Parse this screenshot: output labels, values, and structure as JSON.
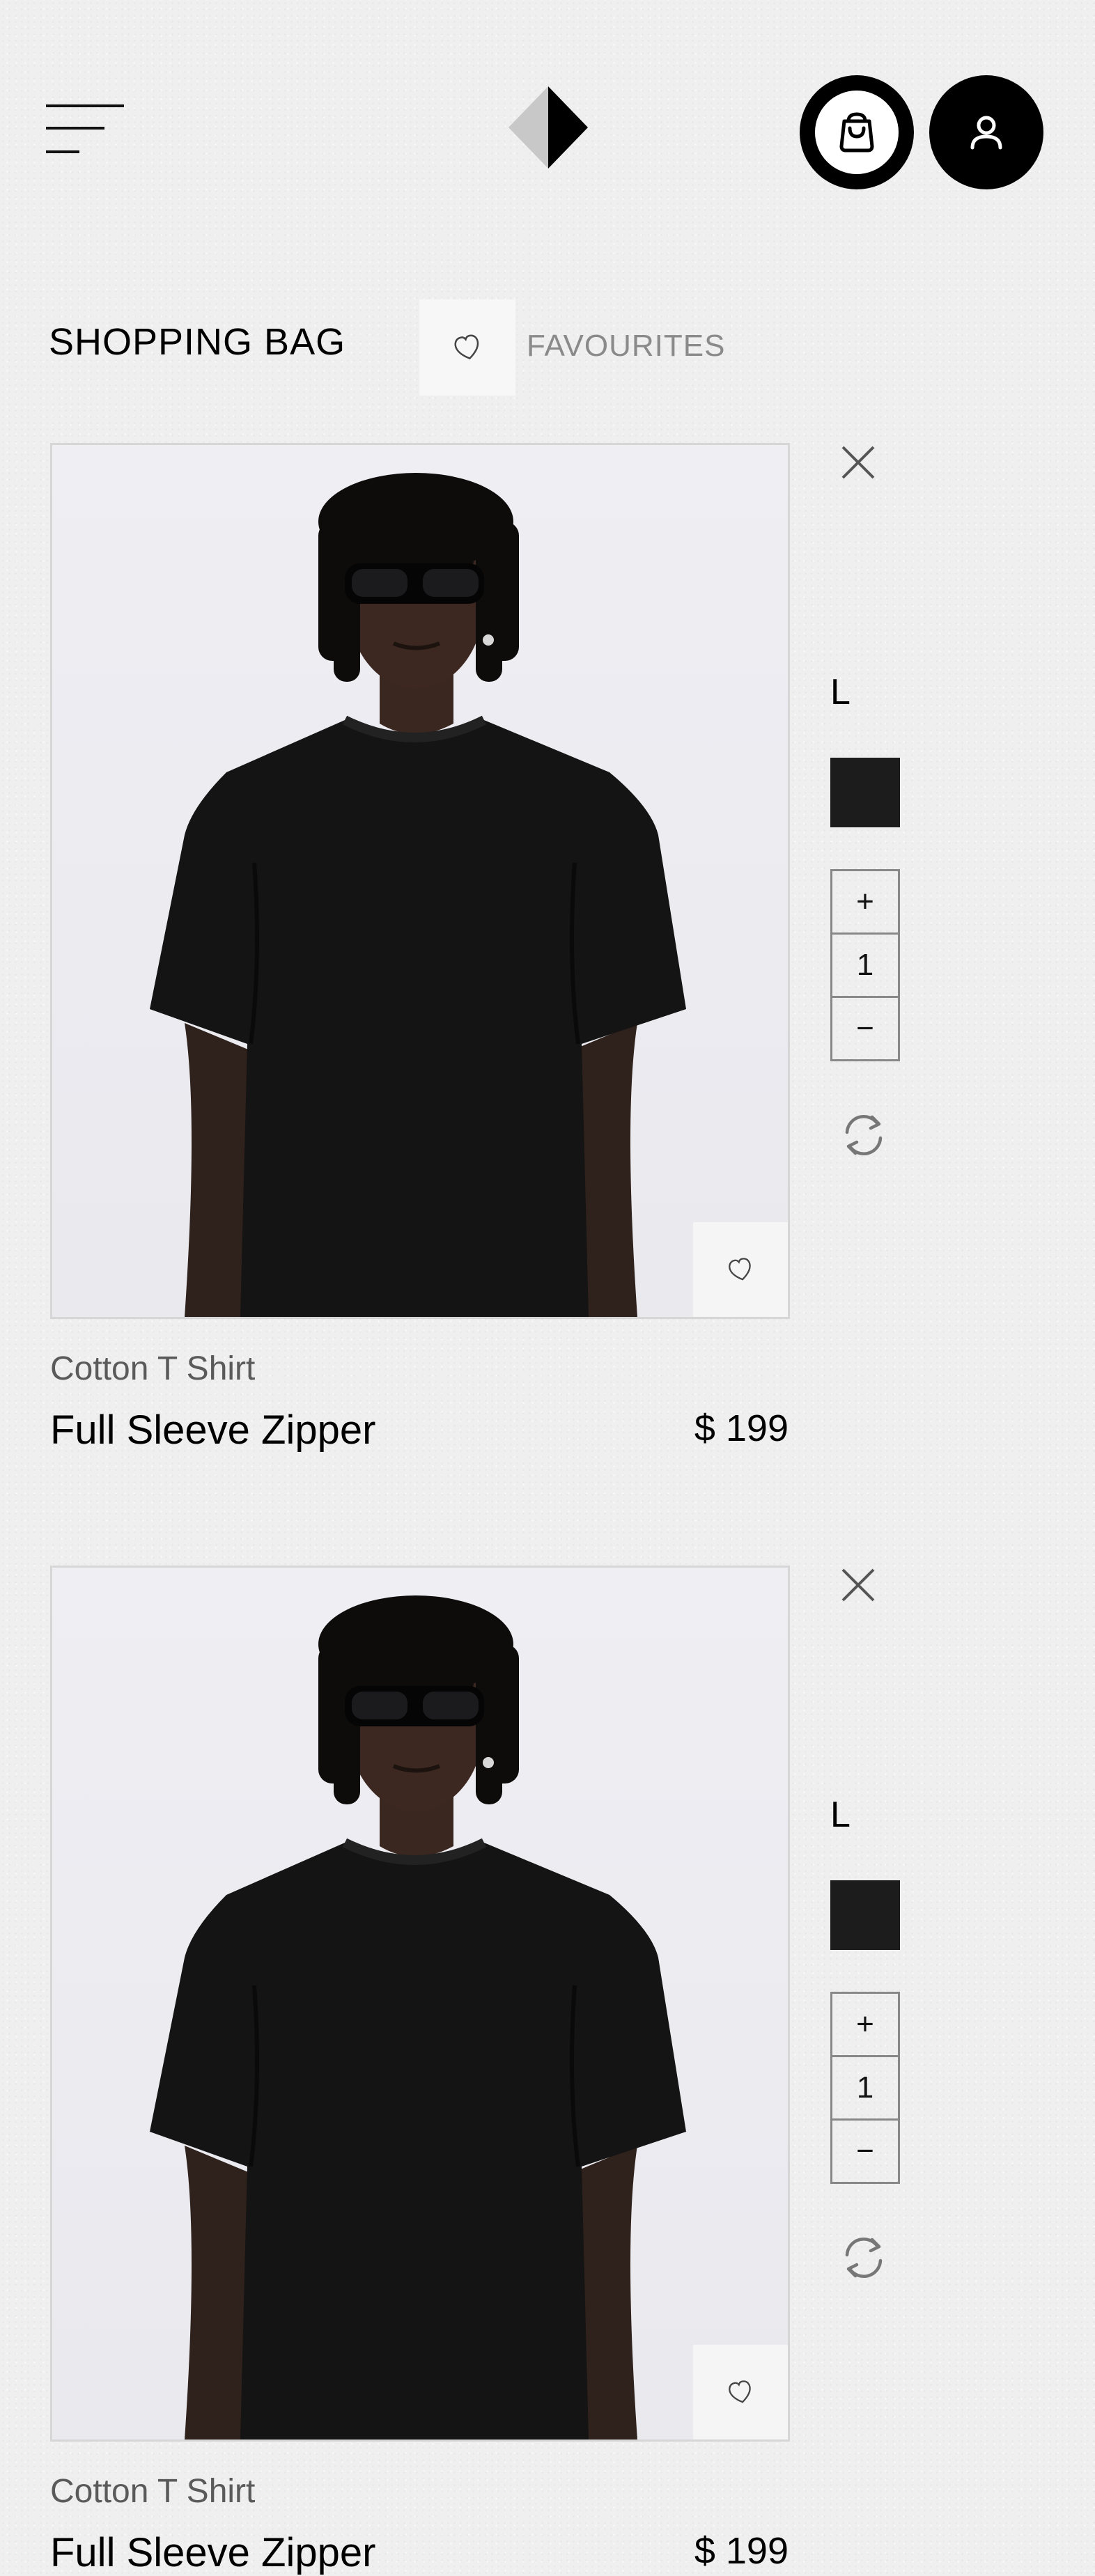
{
  "header": {
    "menu_icon": "hamburger-menu-icon",
    "logo_icon": "diamond-logo-icon",
    "bag_icon": "shopping-bag-icon",
    "user_icon": "user-icon"
  },
  "tabs": {
    "shopping_bag": "SHOPPING BAG",
    "favourites": "FAVOURITES",
    "fav_icon": "heart-icon"
  },
  "items": [
    {
      "subtitle": "Cotton T Shirt",
      "title": "Full Sleeve Zipper",
      "price": "$ 199",
      "size": "L",
      "color": "#1c1c1c",
      "qty_plus": "+",
      "quantity": "1",
      "qty_minus": "−"
    },
    {
      "subtitle": "Cotton T Shirt",
      "title": "Full Sleeve Zipper",
      "price": "$ 199",
      "size": "L",
      "color": "#1c1c1c",
      "qty_plus": "+",
      "quantity": "1",
      "qty_minus": "−"
    }
  ],
  "colors": {
    "background": "#efefef",
    "accent": "#000000",
    "muted_text": "#8a8a8a"
  }
}
